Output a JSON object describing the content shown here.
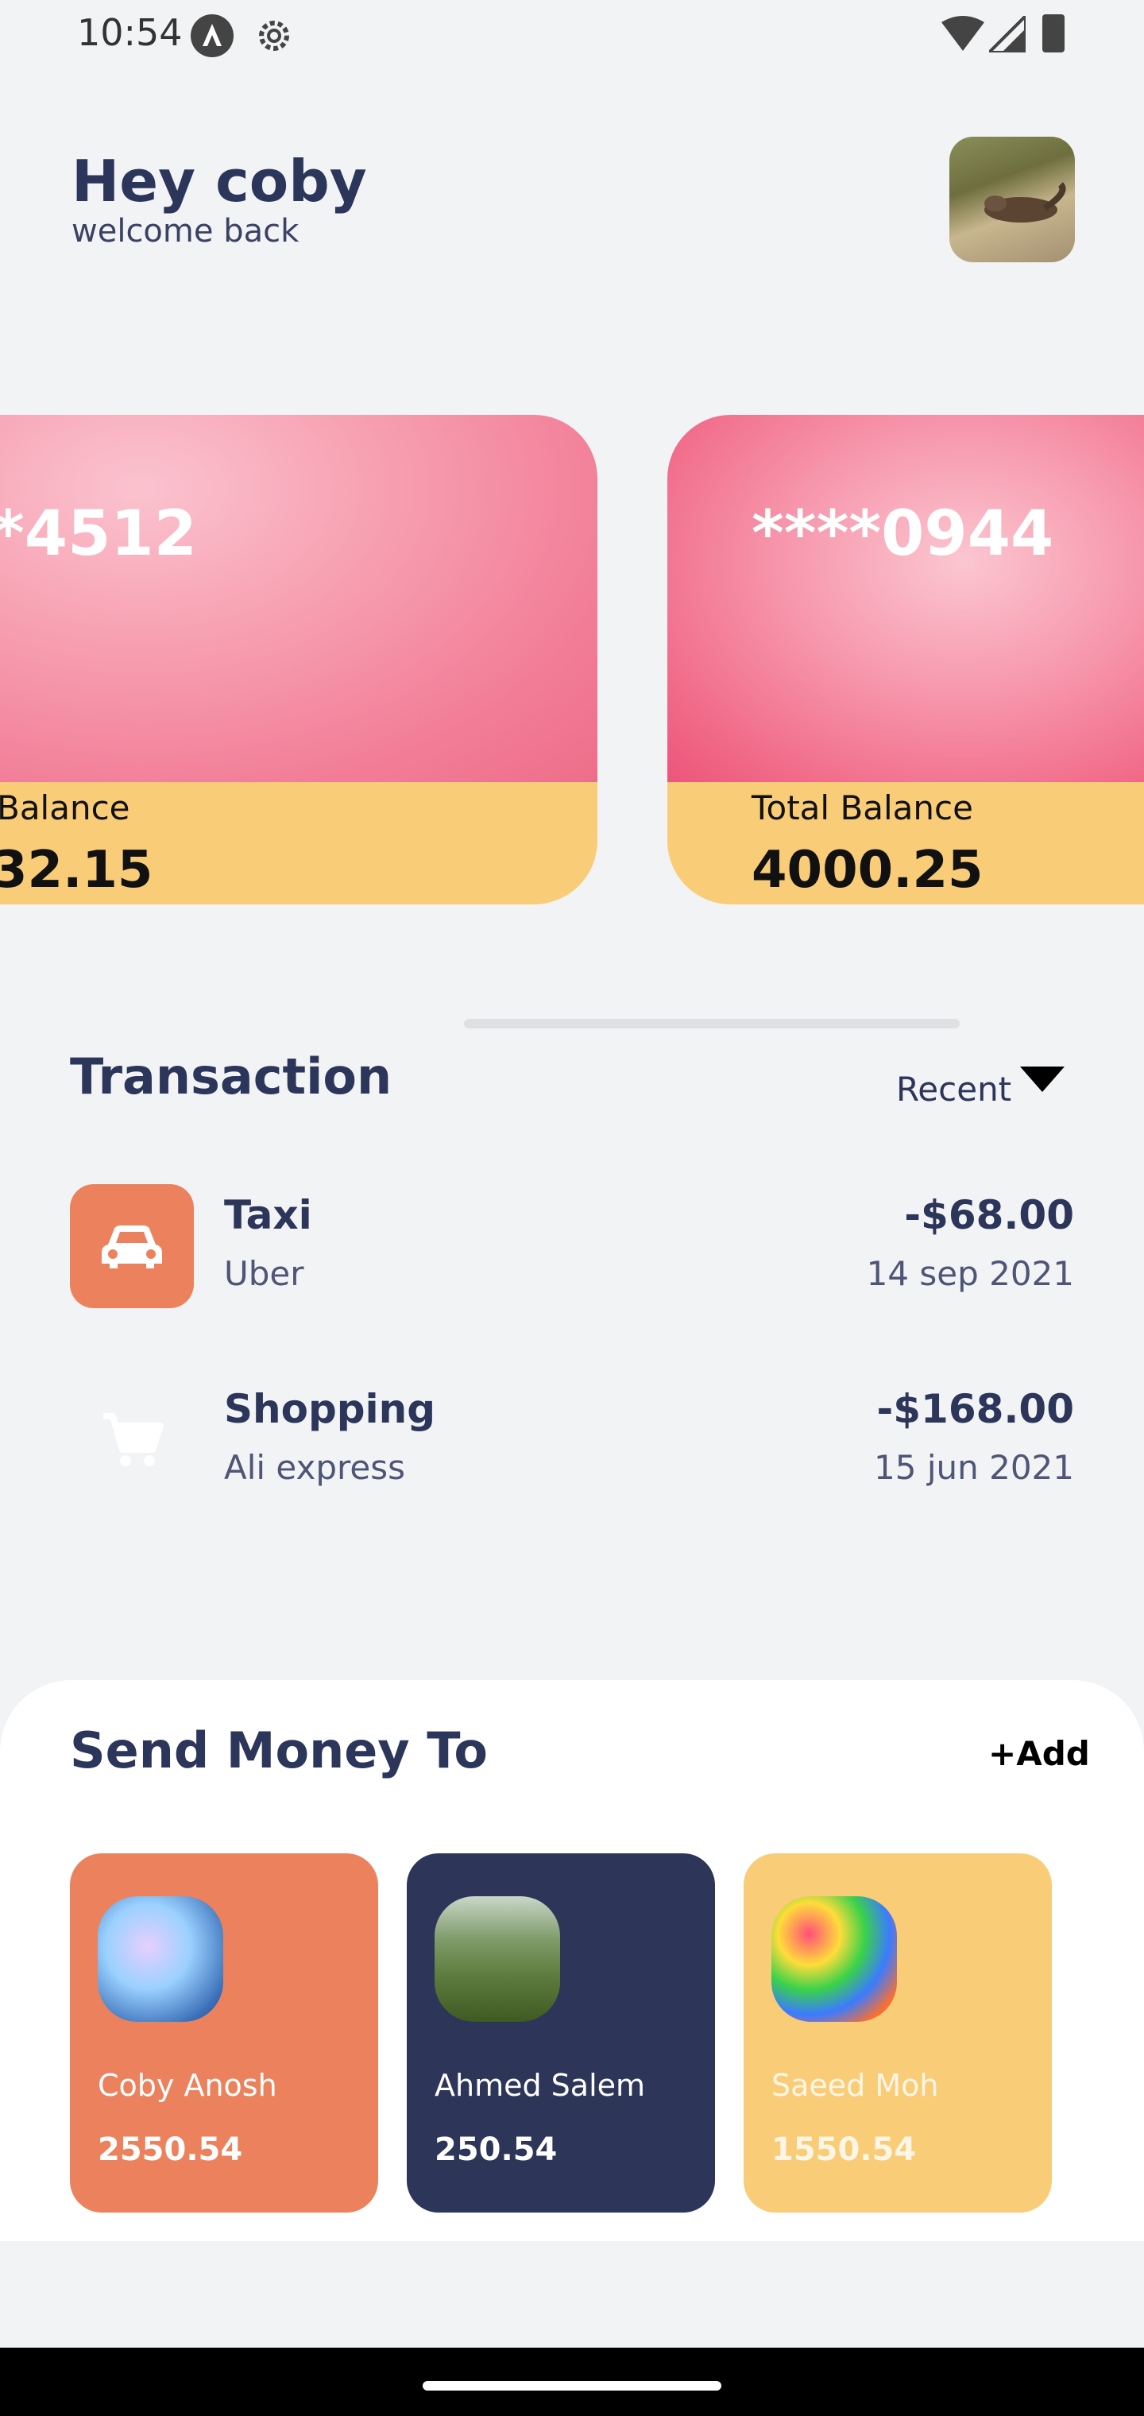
{
  "status_bar": {
    "time": "10:54"
  },
  "header": {
    "greeting": "Hey coby",
    "subtitle": "welcome back"
  },
  "cards": [
    {
      "number": "*4512",
      "label": "Balance",
      "amount": "32.15"
    },
    {
      "number": "****0944",
      "label": "Total Balance",
      "amount": "4000.25"
    }
  ],
  "transactions": {
    "title": "Transaction",
    "filter": "Recent",
    "items": [
      {
        "name": "Taxi",
        "merchant": "Uber",
        "amount": "-$68.00",
        "date": "14 sep 2021",
        "icon": "car-icon"
      },
      {
        "name": "Shopping",
        "merchant": "Ali express",
        "amount": "-$168.00",
        "date": "15 jun 2021",
        "icon": "cart-icon"
      }
    ]
  },
  "send_money": {
    "title": "Send Money To",
    "add_label": "+Add",
    "people": [
      {
        "name": "Coby Anosh",
        "amount": "2550.54",
        "color": "#ec825d"
      },
      {
        "name": "Ahmed Salem",
        "amount": "250.54",
        "color": "#2d3559"
      },
      {
        "name": "Saeed Moh",
        "amount": "1550.54",
        "color": "#f9cc78"
      }
    ]
  },
  "colors": {
    "primary": "#2c355a",
    "orange": "#ec825d",
    "yellow": "#f9cc78",
    "pink": "#f27d97"
  }
}
